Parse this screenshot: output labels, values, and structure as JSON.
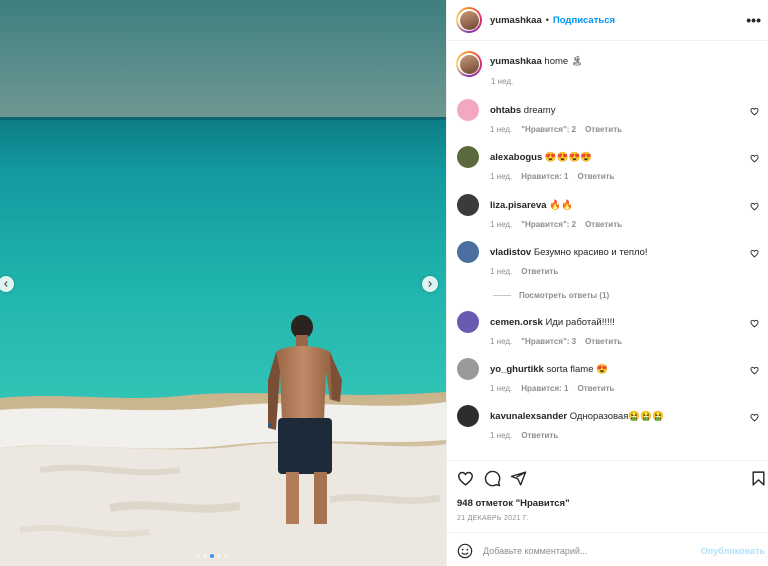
{
  "header": {
    "username": "yumashkaa",
    "separator": "•",
    "follow_label": "Подписаться",
    "more_label": "•••"
  },
  "caption": {
    "username": "yumashkaa",
    "text": "home 🏝",
    "time": "1 нед."
  },
  "comments": [
    {
      "username": "ohtabs",
      "text": "dreamy",
      "time": "1 нед.",
      "likes": "\"Нравится\": 2",
      "reply": "Ответить",
      "avatar_color": "#f2a7c3"
    },
    {
      "username": "alexabogus",
      "text": "😍😍😍😍",
      "time": "1 нед.",
      "likes": "Нравится: 1",
      "reply": "Ответить",
      "avatar_color": "#5a6a3e"
    },
    {
      "username": "liza.pisareva",
      "text": "🔥🔥",
      "time": "1 нед.",
      "likes": "\"Нравится\": 2",
      "reply": "Ответить",
      "avatar_color": "#3b3b3b"
    },
    {
      "username": "vladistov",
      "text": "Безумно красиво и тепло!",
      "time": "1 нед.",
      "likes": "",
      "reply": "Ответить",
      "avatar_color": "#4a6fa0"
    },
    {
      "username": "cemen.orsk",
      "text": "Иди работай!!!!!",
      "time": "1 нед.",
      "likes": "\"Нравится\": 3",
      "reply": "Ответить",
      "avatar_color": "#6a5ab0"
    },
    {
      "username": "yo_ghurtikk",
      "text": "sorta flame 😍",
      "time": "1 нед.",
      "likes": "Нравится: 1",
      "reply": "Ответить",
      "avatar_color": "#9a9a9a"
    },
    {
      "username": "kavunalexsander",
      "text": "Одноразовая🤮🤮🤮",
      "time": "1 нед.",
      "likes": "",
      "reply": "Ответить",
      "avatar_color": "#2d2d2d"
    }
  ],
  "view_replies": "Посмотреть ответы (1)",
  "likes_count": "948 отметок \"Нравится\"",
  "date": "21 ДЕКАБРЬ 2021 Г.",
  "comment_input": {
    "placeholder": "Добавьте комментарий...",
    "publish_label": "Опубликовать"
  },
  "colors": {
    "accent": "#0095f6",
    "muted": "#8e8e8e",
    "publish_disabled": "#b2dffc"
  },
  "carousel": {
    "slide_count": 5,
    "active_slide": 3
  }
}
